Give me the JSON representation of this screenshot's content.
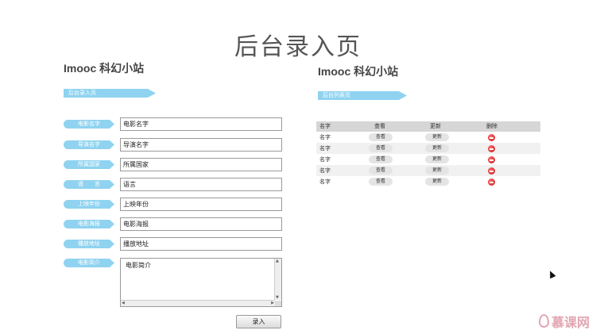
{
  "page_title": "后台录入页",
  "left": {
    "site_title": "Imooc 科幻小站",
    "ribbon": "后台录入页",
    "fields": [
      {
        "label": "电影名字",
        "value": "电影名字"
      },
      {
        "label": "导演名字",
        "value": "导演名字"
      },
      {
        "label": "所属国家",
        "value": "所属国家"
      },
      {
        "label": "语　　言",
        "value": "语言"
      },
      {
        "label": "上映年份",
        "value": "上映年份"
      },
      {
        "label": "电影海报",
        "value": "电影海报"
      },
      {
        "label": "播放地址",
        "value": "播放地址"
      }
    ],
    "summary_label": "电影简介",
    "summary_value": "电影简介",
    "submit": "录入"
  },
  "right": {
    "site_title": "Imooc 科幻小站",
    "ribbon": "后台列表页",
    "columns": [
      "名字",
      "查看",
      "更新",
      "删除"
    ],
    "rows": [
      {
        "name": "名字",
        "view": "查看",
        "update": "更新"
      },
      {
        "name": "名字",
        "view": "查看",
        "update": "更新"
      },
      {
        "name": "名字",
        "view": "查看",
        "update": "更新"
      },
      {
        "name": "名字",
        "view": "查看",
        "update": "更新"
      },
      {
        "name": "名字",
        "view": "查看",
        "update": "更新"
      }
    ]
  },
  "watermark": "慕课网",
  "colors": {
    "ribbon": "#8fd3f0",
    "delete": "#d01c1c"
  }
}
